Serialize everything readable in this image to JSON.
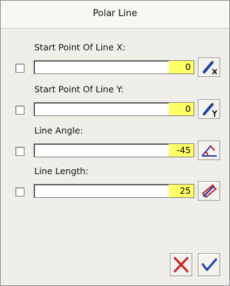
{
  "window": {
    "title": "Polar Line"
  },
  "fields": [
    {
      "label": "Start Point Of Line X:",
      "value": "0",
      "tool_icon": "pencil-x-icon"
    },
    {
      "label": "Start Point Of Line Y:",
      "value": "0",
      "tool_icon": "pencil-y-icon"
    },
    {
      "label": "Line Angle:",
      "value": "-45",
      "tool_icon": "angle-icon"
    },
    {
      "label": "Line Length:",
      "value": "25",
      "tool_icon": "ruler-pencil-icon"
    }
  ],
  "actions": {
    "cancel_icon": "red-x-icon",
    "ok_icon": "blue-check-icon"
  },
  "colors": {
    "highlight": "#ffff66",
    "accent_blue": "#1f3fae",
    "accent_red": "#d11a1a"
  }
}
